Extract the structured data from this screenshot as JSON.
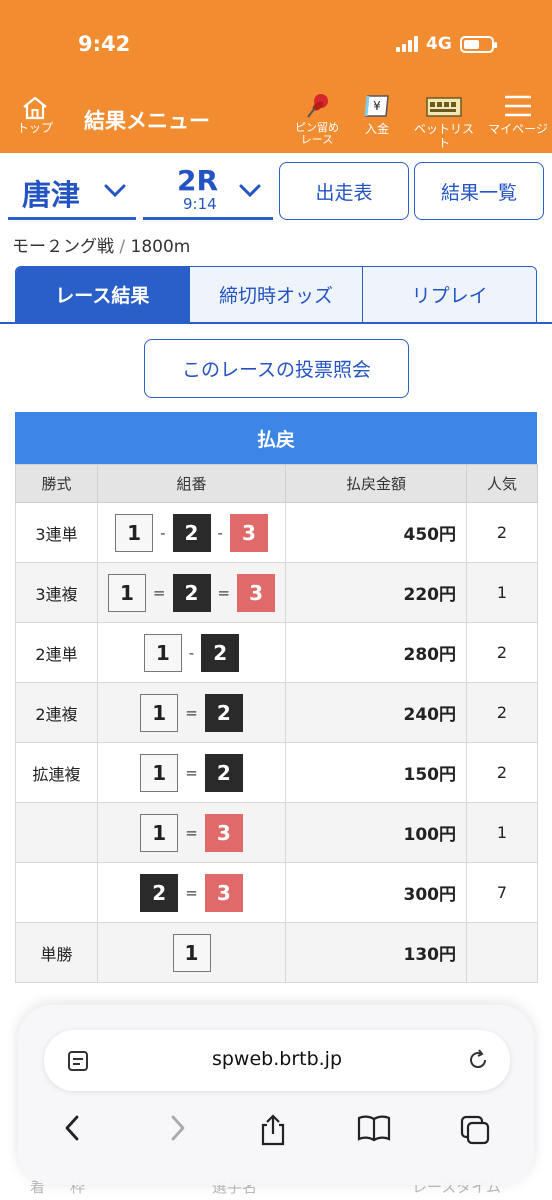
{
  "status": {
    "time": "9:42",
    "network": "4G"
  },
  "header": {
    "home_label": "トップ",
    "title": "結果メニュー",
    "nav": [
      {
        "label": "ピン留め\nレース",
        "icon": "pushpin-icon"
      },
      {
        "label": "入金",
        "icon": "yen-icon"
      },
      {
        "label": "ベットリスト",
        "icon": "ticket-icon"
      },
      {
        "label": "マイページ",
        "icon": "hamburger-menu-icon"
      }
    ]
  },
  "selector": {
    "venue": "唐津",
    "race_no": "2R",
    "race_time": "9:14",
    "entry_button": "出走表",
    "results_button": "結果一覧"
  },
  "race_info": {
    "name": "モー２ング戦",
    "separator": "/",
    "distance": "1800m"
  },
  "tabs": [
    "レース結果",
    "締切時オッズ",
    "リプレイ"
  ],
  "active_tab": "レース結果",
  "vote_button": "このレースの投票照会",
  "payout": {
    "title": "払戻",
    "columns": [
      "勝式",
      "組番",
      "払戻金額",
      "人気"
    ],
    "rows": [
      {
        "type": "3連単",
        "combo": [
          "1",
          "-",
          "2",
          "-",
          "3"
        ],
        "amount": "450円",
        "pop": "2"
      },
      {
        "type": "3連複",
        "combo": [
          "1",
          "=",
          "2",
          "=",
          "3"
        ],
        "amount": "220円",
        "pop": "1"
      },
      {
        "type": "2連単",
        "combo": [
          "1",
          "-",
          "2"
        ],
        "amount": "280円",
        "pop": "2"
      },
      {
        "type": "2連複",
        "combo": [
          "1",
          "=",
          "2"
        ],
        "amount": "240円",
        "pop": "2"
      },
      {
        "type": "拡連複",
        "combo": [
          "1",
          "=",
          "2"
        ],
        "amount": "150円",
        "pop": "2"
      },
      {
        "type": "",
        "combo": [
          "1",
          "=",
          "3"
        ],
        "amount": "100円",
        "pop": "1"
      },
      {
        "type": "",
        "combo": [
          "2",
          "=",
          "3"
        ],
        "amount": "300円",
        "pop": "7"
      },
      {
        "type": "単勝",
        "combo": [
          "1"
        ],
        "amount": "130円",
        "pop": ""
      }
    ]
  },
  "browser": {
    "url": "spweb.brtb.jp"
  },
  "background_headers": [
    "着",
    "枠",
    "選手名",
    "レースタイム"
  ],
  "colors": {
    "header": "#f28c30",
    "accent": "#2a5ec8",
    "payout_header": "#3d86e8",
    "boat1": "#f7f7f7",
    "boat2": "#2a2a2a",
    "boat3": "#e06a6a"
  }
}
